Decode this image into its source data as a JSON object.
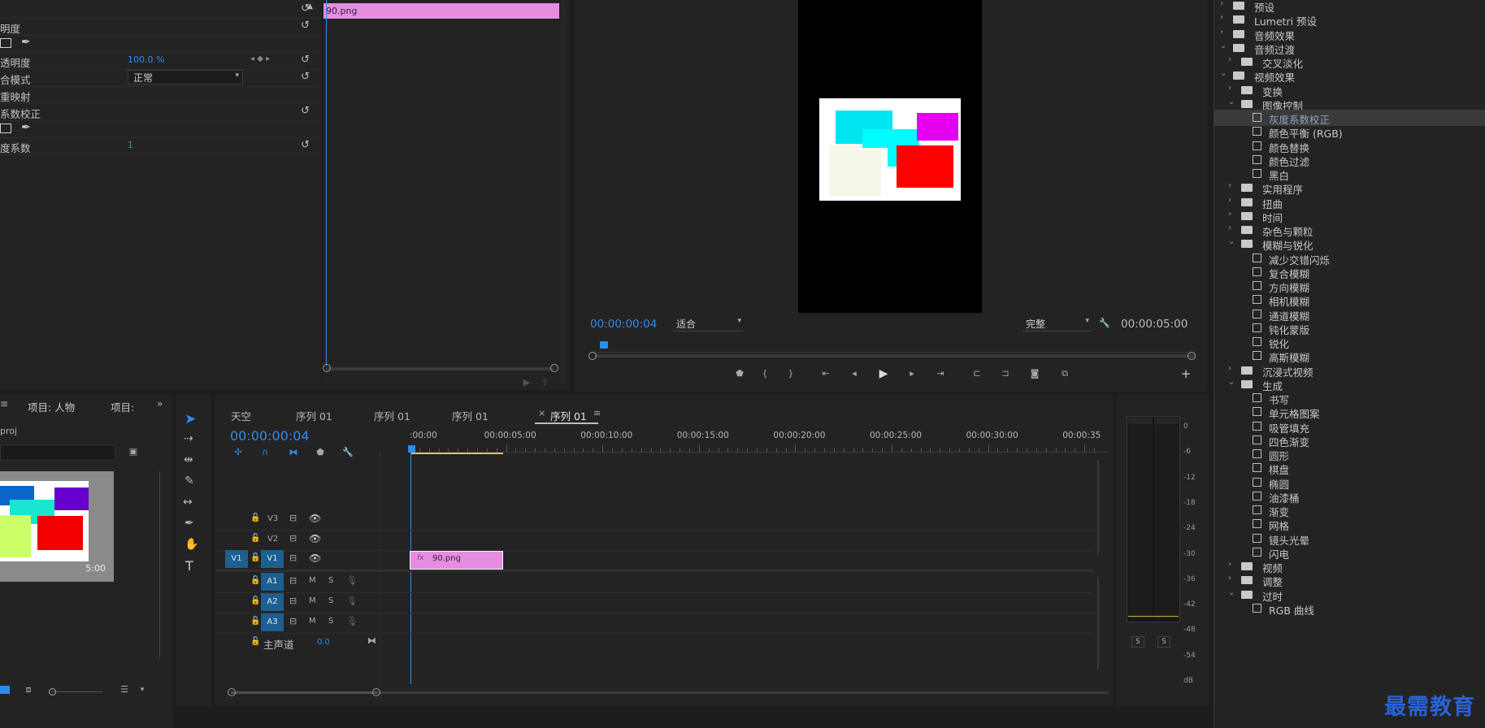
{
  "effect_controls": {
    "clip_bar_label": "90.png",
    "rows": [
      {
        "label": "",
        "value": "",
        "reset": true,
        "kind": "header"
      },
      {
        "label": "明度",
        "value": "",
        "reset": true
      },
      {
        "label": "",
        "value": "",
        "reset": false,
        "kind": "mask-tools"
      },
      {
        "label": "透明度",
        "value": "100.0 %",
        "reset": true,
        "keyframe": true
      },
      {
        "label": "合模式",
        "value": "正常",
        "reset": true,
        "dropdown": true
      },
      {
        "label": "重映射",
        "value": "",
        "reset": false
      },
      {
        "label": "系数校正",
        "value": "",
        "reset": true
      },
      {
        "label": "",
        "value": "",
        "reset": false,
        "kind": "mask-tools"
      },
      {
        "label": "度系数",
        "value": "1",
        "reset": true
      }
    ]
  },
  "program_monitor": {
    "timecode_left": "00:00:00:04",
    "fit_option": "适合",
    "quality_option": "完整",
    "timecode_right": "00:00:05:00",
    "colors": {
      "cyan": "#00e5f0",
      "magenta": "#e600f0",
      "red": "#ff0000",
      "cream": "#f5f8e8",
      "white": "#ffffff"
    }
  },
  "project": {
    "tab_label": "项目: 人物",
    "tab2_label": "项目:",
    "filename": "proj",
    "thumb_duration": "5:00",
    "colors": {
      "blue": "#0a66cc",
      "purple": "#6600cc",
      "teal": "#19e6cc",
      "lime": "#ccff66",
      "red": "#f20000"
    }
  },
  "timeline": {
    "tabs": [
      "天空",
      "序列 01",
      "序列 01",
      "序列 01",
      "序列 01"
    ],
    "timecode": "00:00:00:04",
    "ruler": [
      ":00:00",
      "00:00:05:00",
      "00:00:10:00",
      "00:00:15:00",
      "00:00:20:00",
      "00:00:25:00",
      "00:00:30:00",
      "00:00:35"
    ],
    "video_tracks": [
      "V3",
      "V2",
      "V1"
    ],
    "source_patch": "V1",
    "audio_tracks": [
      "A1",
      "A2",
      "A3"
    ],
    "mute": "M",
    "solo": "S",
    "master_label": "主声道",
    "master_value": "0.0",
    "clip_label": "90.png",
    "clip_fx": "fx"
  },
  "audio_meters": {
    "scale": [
      "0",
      "-6",
      "-12",
      "-18",
      "-24",
      "-30",
      "-36",
      "-42",
      "-48",
      "-54",
      "dB"
    ],
    "solo_labels": [
      "S",
      "S"
    ]
  },
  "effects": {
    "items": [
      {
        "label": "预设",
        "level": 0,
        "type": "folder",
        "open": false
      },
      {
        "label": "Lumetri 预设",
        "level": 0,
        "type": "folder",
        "open": false
      },
      {
        "label": "音频效果",
        "level": 0,
        "type": "folder",
        "open": false
      },
      {
        "label": "音频过渡",
        "level": 0,
        "type": "folder",
        "open": true
      },
      {
        "label": "交叉淡化",
        "level": 1,
        "type": "folder",
        "open": false
      },
      {
        "label": "视频效果",
        "level": 0,
        "type": "folder",
        "open": true
      },
      {
        "label": "变换",
        "level": 1,
        "type": "folder",
        "open": false
      },
      {
        "label": "图像控制",
        "level": 1,
        "type": "folder",
        "open": true
      },
      {
        "label": "灰度系数校正",
        "level": 2,
        "type": "fx",
        "selected": true
      },
      {
        "label": "颜色平衡 (RGB)",
        "level": 2,
        "type": "fx"
      },
      {
        "label": "颜色替换",
        "level": 2,
        "type": "fx"
      },
      {
        "label": "颜色过滤",
        "level": 2,
        "type": "fx"
      },
      {
        "label": "黑白",
        "level": 2,
        "type": "fx"
      },
      {
        "label": "实用程序",
        "level": 1,
        "type": "folder",
        "open": false
      },
      {
        "label": "扭曲",
        "level": 1,
        "type": "folder",
        "open": false
      },
      {
        "label": "时间",
        "level": 1,
        "type": "folder",
        "open": false
      },
      {
        "label": "杂色与颗粒",
        "level": 1,
        "type": "folder",
        "open": false
      },
      {
        "label": "模糊与锐化",
        "level": 1,
        "type": "folder",
        "open": true
      },
      {
        "label": "减少交错闪烁",
        "level": 2,
        "type": "fx"
      },
      {
        "label": "复合模糊",
        "level": 2,
        "type": "fx"
      },
      {
        "label": "方向模糊",
        "level": 2,
        "type": "fx"
      },
      {
        "label": "相机模糊",
        "level": 2,
        "type": "fx"
      },
      {
        "label": "通道模糊",
        "level": 2,
        "type": "fx"
      },
      {
        "label": "钝化蒙版",
        "level": 2,
        "type": "fx"
      },
      {
        "label": "锐化",
        "level": 2,
        "type": "fx"
      },
      {
        "label": "高斯模糊",
        "level": 2,
        "type": "fx"
      },
      {
        "label": "沉浸式视频",
        "level": 1,
        "type": "folder",
        "open": false
      },
      {
        "label": "生成",
        "level": 1,
        "type": "folder",
        "open": true
      },
      {
        "label": "书写",
        "level": 2,
        "type": "fx"
      },
      {
        "label": "单元格图案",
        "level": 2,
        "type": "fx"
      },
      {
        "label": "吸管填充",
        "level": 2,
        "type": "fx"
      },
      {
        "label": "四色渐变",
        "level": 2,
        "type": "fx"
      },
      {
        "label": "圆形",
        "level": 2,
        "type": "fx"
      },
      {
        "label": "棋盘",
        "level": 2,
        "type": "fx"
      },
      {
        "label": "椭圆",
        "level": 2,
        "type": "fx"
      },
      {
        "label": "油漆桶",
        "level": 2,
        "type": "fx"
      },
      {
        "label": "渐变",
        "level": 2,
        "type": "fx"
      },
      {
        "label": "网格",
        "level": 2,
        "type": "fx"
      },
      {
        "label": "镜头光晕",
        "level": 2,
        "type": "fx"
      },
      {
        "label": "闪电",
        "level": 2,
        "type": "fx"
      },
      {
        "label": "视频",
        "level": 1,
        "type": "folder",
        "open": false
      },
      {
        "label": "调整",
        "level": 1,
        "type": "folder",
        "open": false
      },
      {
        "label": "过时",
        "level": 1,
        "type": "folder",
        "open": true
      },
      {
        "label": "RGB 曲线",
        "level": 2,
        "type": "fx"
      }
    ]
  },
  "watermark": "最需教育"
}
